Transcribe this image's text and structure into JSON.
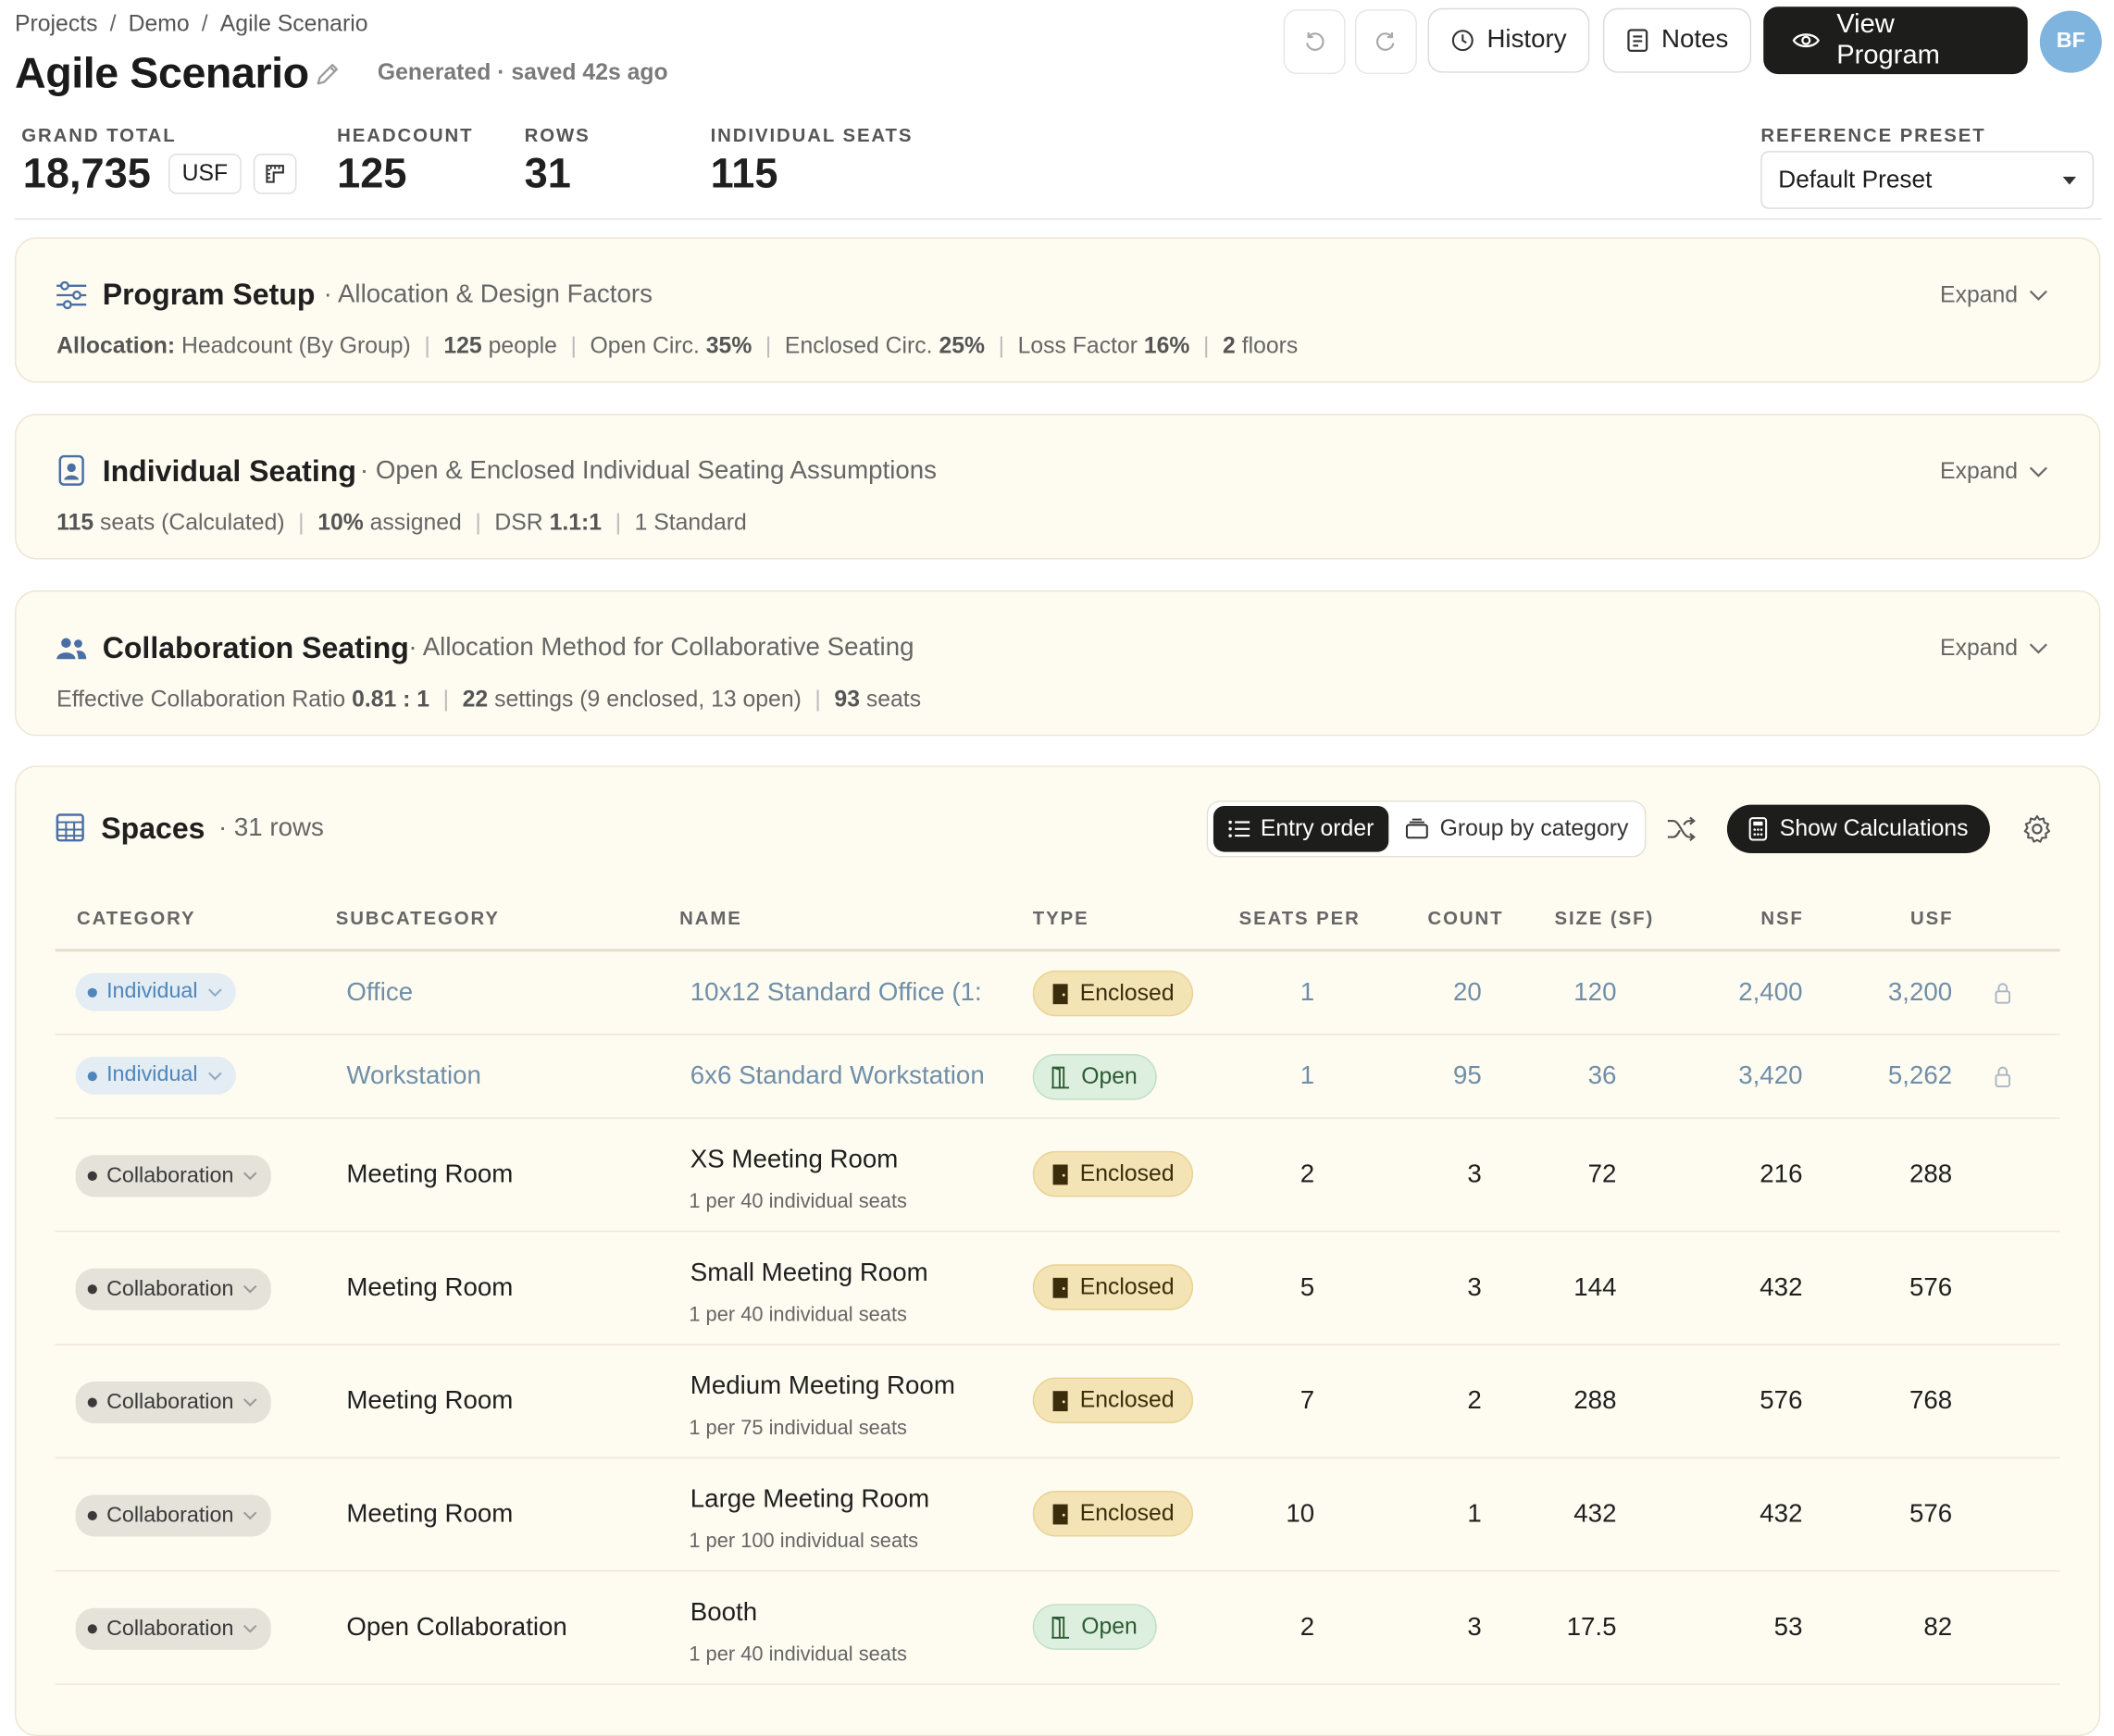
{
  "breadcrumb": [
    "Projects",
    "Demo",
    "Agile Scenario"
  ],
  "page": {
    "title": "Agile Scenario",
    "status": "Generated · saved 42s ago"
  },
  "toolbar": {
    "history": "History",
    "notes": "Notes",
    "view_program": "View Program",
    "avatar_initials": "BF"
  },
  "stats": {
    "grand_total_label": "GRAND TOTAL",
    "grand_total": "18,735",
    "unit": "USF",
    "headcount_label": "HEADCOUNT",
    "headcount": "125",
    "rows_label": "ROWS",
    "rows": "31",
    "seats_label": "INDIVIDUAL SEATS",
    "seats": "115",
    "preset_label": "REFERENCE PRESET",
    "preset": "Default Preset"
  },
  "panels": {
    "program": {
      "title": "Program Setup",
      "subtitle": "· Allocation & Design Factors",
      "expand": "Expand",
      "alloc_label": "Allocation:",
      "alloc_value": "Headcount (By Group)",
      "people_n": "125",
      "people_t": "people",
      "open_circ_t": "Open Circ.",
      "open_circ_n": "35%",
      "enc_circ_t": "Enclosed Circ.",
      "enc_circ_n": "25%",
      "loss_t": "Loss Factor",
      "loss_n": "16%",
      "floors_n": "2",
      "floors_t": "floors"
    },
    "individual": {
      "title": "Individual Seating",
      "subtitle": "· Open & Enclosed Individual Seating Assumptions",
      "expand": "Expand",
      "seats_n": "115",
      "seats_t": "seats (Calculated)",
      "assigned_n": "10%",
      "assigned_t": "assigned",
      "dsr_t": "DSR",
      "dsr_n": "1.1:1",
      "standard": "1 Standard"
    },
    "collab": {
      "title": "Collaboration Seating",
      "subtitle": "· Allocation Method for Collaborative Seating",
      "expand": "Expand",
      "ratio_t": "Effective Collaboration Ratio",
      "ratio_n": "0.81 : 1",
      "settings_n": "22",
      "settings_t": "settings (9 enclosed, 13 open)",
      "seats_n": "93",
      "seats_t": "seats"
    }
  },
  "spaces": {
    "title": "Spaces",
    "count": "· 31 rows",
    "entry_order": "Entry order",
    "group_by": "Group by category",
    "show_calc": "Show Calculations",
    "columns": {
      "category": "CATEGORY",
      "subcategory": "SUBCATEGORY",
      "name": "NAME",
      "type": "TYPE",
      "seats": "SEATS PER",
      "count": "COUNT",
      "size": "SIZE (SF)",
      "nsf": "NSF",
      "usf": "USF"
    },
    "rows": [
      {
        "category": "Individual",
        "subcategory": "Office",
        "name": "10x12 Standard Office (1:",
        "note": "",
        "type": "Enclosed",
        "seats": "1",
        "count": "20",
        "size": "120",
        "nsf": "2,400",
        "usf": "3,200"
      },
      {
        "category": "Individual",
        "subcategory": "Workstation",
        "name": "6x6 Standard Workstation",
        "note": "",
        "type": "Open",
        "seats": "1",
        "count": "95",
        "size": "36",
        "nsf": "3,420",
        "usf": "5,262"
      },
      {
        "category": "Collaboration",
        "subcategory": "Meeting Room",
        "name": "XS Meeting Room",
        "note": "1 per 40 individual seats",
        "type": "Enclosed",
        "seats": "2",
        "count": "3",
        "size": "72",
        "nsf": "216",
        "usf": "288"
      },
      {
        "category": "Collaboration",
        "subcategory": "Meeting Room",
        "name": "Small Meeting Room",
        "note": "1 per 40 individual seats",
        "type": "Enclosed",
        "seats": "5",
        "count": "3",
        "size": "144",
        "nsf": "432",
        "usf": "576"
      },
      {
        "category": "Collaboration",
        "subcategory": "Meeting Room",
        "name": "Medium Meeting Room",
        "note": "1 per 75 individual seats",
        "type": "Enclosed",
        "seats": "7",
        "count": "2",
        "size": "288",
        "nsf": "576",
        "usf": "768"
      },
      {
        "category": "Collaboration",
        "subcategory": "Meeting Room",
        "name": "Large Meeting Room",
        "note": "1 per 100 individual seats",
        "type": "Enclosed",
        "seats": "10",
        "count": "1",
        "size": "432",
        "nsf": "432",
        "usf": "576"
      },
      {
        "category": "Collaboration",
        "subcategory": "Open Collaboration",
        "name": "Booth",
        "note": "1 per 40 individual seats",
        "type": "Open",
        "seats": "2",
        "count": "3",
        "size": "17.5",
        "nsf": "53",
        "usf": "82"
      }
    ]
  }
}
